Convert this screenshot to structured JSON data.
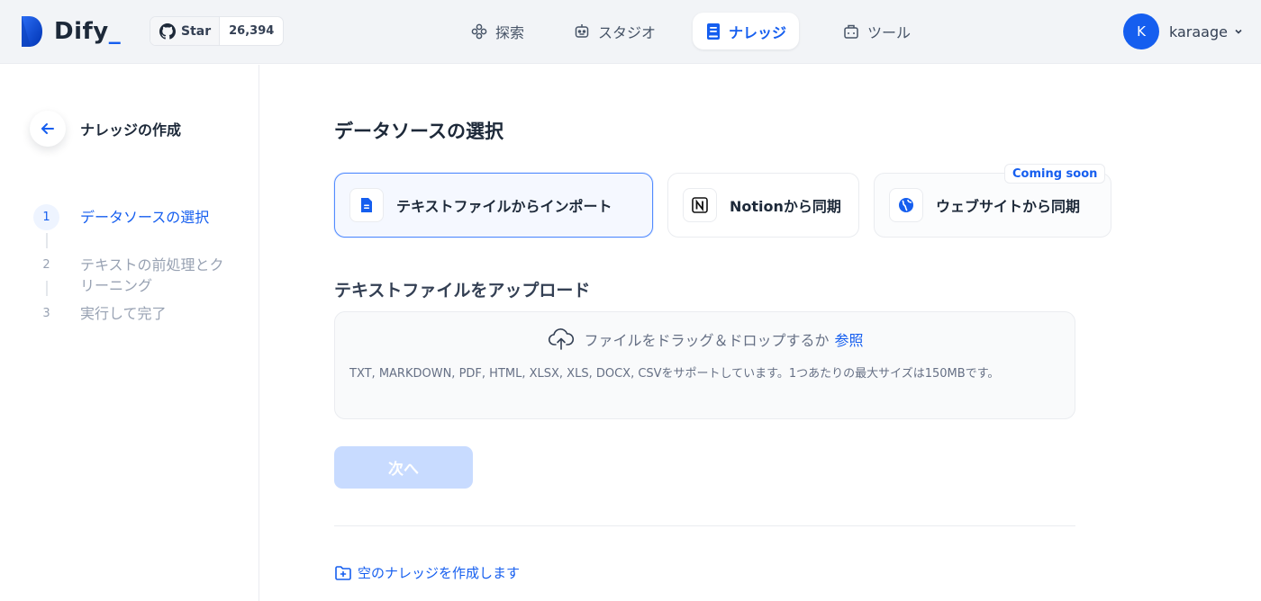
{
  "header": {
    "brand": "Dify",
    "brand_suffix": "_",
    "github": {
      "star_label": "Star",
      "count": "26,394"
    },
    "nav": [
      {
        "label": "探索",
        "icon": "explore-icon"
      },
      {
        "label": "スタジオ",
        "icon": "robot-icon"
      },
      {
        "label": "ナレッジ",
        "icon": "book-icon",
        "active": true
      },
      {
        "label": "ツール",
        "icon": "toolbox-icon"
      }
    ],
    "user": {
      "initial": "K",
      "name": "karaage"
    }
  },
  "sidebar": {
    "title": "ナレッジの作成",
    "steps": [
      {
        "num": "1",
        "label": "データソースの選択",
        "active": true
      },
      {
        "num": "2",
        "label": "テキストの前処理とクリーニング",
        "active": false
      },
      {
        "num": "3",
        "label": "実行して完了",
        "active": false
      }
    ]
  },
  "main": {
    "section_title": "データソースの選択",
    "sources": [
      {
        "label": "テキストファイルからインポート",
        "icon": "file-icon",
        "selected": true
      },
      {
        "label": "Notionから同期",
        "icon": "notion-icon",
        "selected": false
      },
      {
        "label": "ウェブサイトから同期",
        "icon": "globe-icon",
        "selected": false,
        "badge": "Coming soon"
      }
    ],
    "upload": {
      "title": "テキストファイルをアップロード",
      "drop_text": "ファイルをドラッグ＆ドロップするか",
      "browse": "参照",
      "tip": "TXT, MARKDOWN, PDF, HTML, XLSX, XLS, DOCX, CSVをサポートしています。1つあたりの最大サイズは150MBです。"
    },
    "next_label": "次へ",
    "empty_link": "空のナレッジを作成します"
  },
  "colors": {
    "accent": "#155eef",
    "disabled_button": "#c8dbff",
    "muted": "#98a2b3"
  }
}
